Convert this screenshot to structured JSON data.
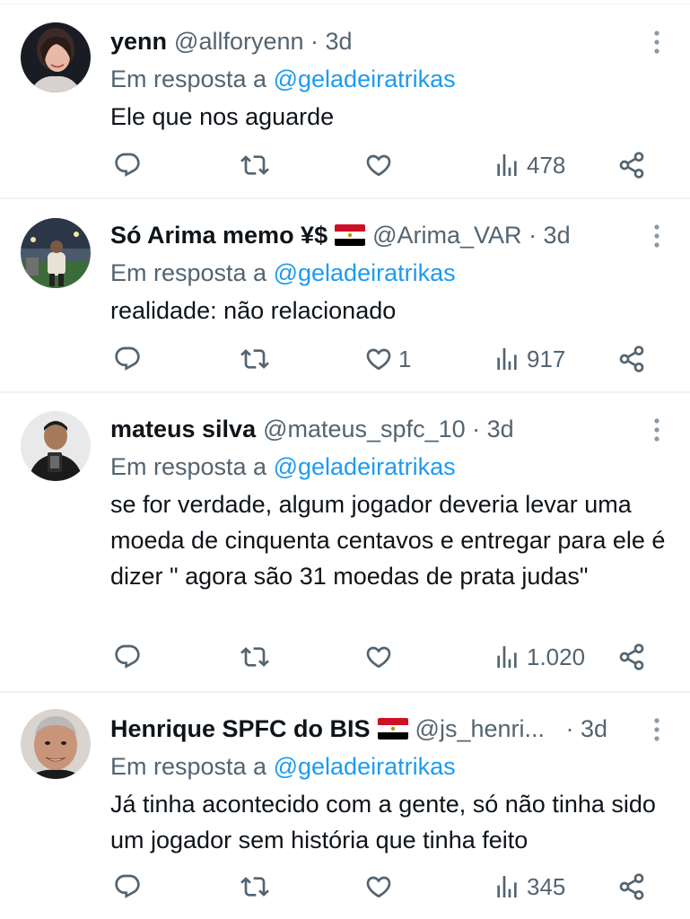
{
  "reply_prefix": "Em resposta a",
  "tweets": [
    {
      "name": "yenn",
      "handle": "@allforyenn",
      "time": "· 3d",
      "reply_to": "@geladeiratrikas",
      "text": "Ele que nos aguarde",
      "replies": "",
      "retweets": "",
      "likes": "",
      "views": "478"
    },
    {
      "name": "Só Arima memo ¥$",
      "handle": "@Arima_VAR",
      "time": "· 3d",
      "reply_to": "@geladeiratrikas",
      "text": "realidade: não relacionado",
      "replies": "",
      "retweets": "",
      "likes": "1",
      "views": "917"
    },
    {
      "name": "mateus silva",
      "handle": "@mateus_spfc_10",
      "time": "· 3d",
      "reply_to": "@geladeiratrikas",
      "text": "se for verdade, algum jogador deveria levar uma moeda de cinquenta centavos e entregar para ele é dizer \" agora são 31 moedas de prata judas\"",
      "replies": "",
      "retweets": "",
      "likes": "",
      "views": "1.020"
    },
    {
      "name": "Henrique SPFC do BIS",
      "handle": "@js_henri...",
      "time": "· 3d",
      "reply_to": "@geladeiratrikas",
      "text": "Já tinha acontecido com a gente, só não tinha sido um jogador sem história que tinha feito",
      "replies": "",
      "retweets": "",
      "likes": "",
      "views": "345"
    }
  ],
  "colors": {
    "text": "#0f1419",
    "secondary": "#536471",
    "link": "#1d9bf0",
    "divider": "#eff3f4",
    "flag_red": "#ce1126",
    "flag_black": "#000000"
  },
  "icons": [
    "reply-icon",
    "retweet-icon",
    "like-icon",
    "views-icon",
    "share-icon",
    "more-icon",
    "egypt-flag-icon"
  ]
}
